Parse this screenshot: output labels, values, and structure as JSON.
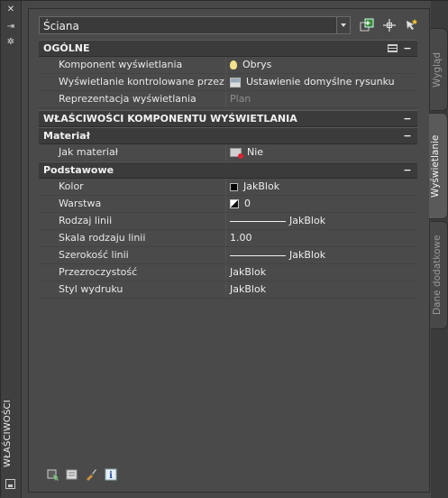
{
  "palette_title": "WŁAŚCIWOŚCI",
  "style_dropdown": {
    "value": "Ściana"
  },
  "categories": {
    "general": {
      "label": "OGÓLNE"
    },
    "display_component_props": {
      "label": "WŁAŚCIWOŚCI KOMPONENTU WYŚWIETLANIA"
    },
    "material": {
      "label": "Materiał"
    },
    "basic": {
      "label": "Podstawowe"
    }
  },
  "general_rows": [
    {
      "label": "Komponent wyświetlania",
      "value": "Obrys",
      "icon": "lightbulb-icon"
    },
    {
      "label": "Wyświetlanie kontrolowane przez",
      "value": "Ustawienie domyślne rysunku",
      "icon": "drawing-default-icon"
    },
    {
      "label": "Reprezentacja wyświetlania",
      "value": "Plan"
    }
  ],
  "material_rows": [
    {
      "label": "Jak materiał",
      "value": "Nie",
      "icon": "material-icon"
    }
  ],
  "basic_rows": [
    {
      "label": "Kolor",
      "value": "JakBlok"
    },
    {
      "label": "Warstwa",
      "value": "0"
    },
    {
      "label": "Rodzaj linii",
      "value": "JakBlok"
    },
    {
      "label": "Skala rodzaju linii",
      "value": "1.00"
    },
    {
      "label": "Szerokość linii",
      "value": "JakBlok"
    },
    {
      "label": "Przezroczystość",
      "value": "JakBlok"
    },
    {
      "label": "Styl wydruku",
      "value": "JakBlok"
    }
  ],
  "tabs": [
    {
      "label": "Wygląd",
      "active": false
    },
    {
      "label": "Wyświetlanie",
      "active": true
    },
    {
      "label": "Dane dodatkowe",
      "active": false
    }
  ],
  "colors": {
    "background": "#454545",
    "category_band": "#3b3b3b",
    "text": "#e6e6e6",
    "dim_text": "#8e8e8e"
  }
}
